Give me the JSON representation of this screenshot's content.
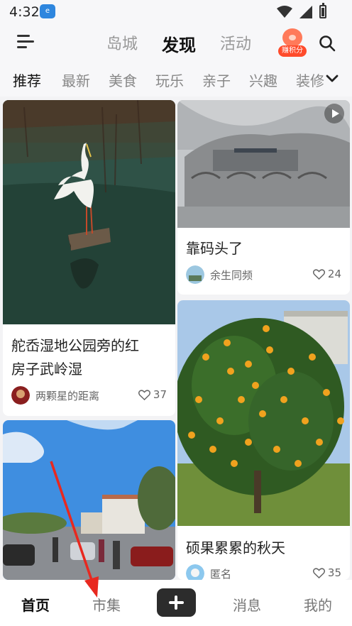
{
  "status_bar": {
    "time": "4:32",
    "app_icon": "app-badge-icon"
  },
  "header": {
    "tabs": [
      {
        "label": "岛城",
        "active": false
      },
      {
        "label": "发现",
        "active": true
      },
      {
        "label": "活动",
        "active": false
      }
    ],
    "points_label": "赚积分",
    "icons": [
      "menu-icon",
      "search-icon"
    ]
  },
  "categories": {
    "items": [
      "推荐",
      "最新",
      "美食",
      "玩乐",
      "亲子",
      "兴趣",
      "装修"
    ],
    "active_index": 0
  },
  "feed": {
    "cards": [
      {
        "title_line1": "舵岙湿地公园旁的红",
        "title_line2": "房子武岭湿",
        "author": "两颗星的距离",
        "likes": "37"
      },
      {
        "title_line1": "靠码头了",
        "title_line2": "",
        "author": "余生同频",
        "likes": "24",
        "has_video": true
      },
      {
        "title_line1": "硕果累累的秋天",
        "title_line2": "",
        "author": "匿名",
        "likes": "35"
      },
      {
        "title_line1": "",
        "title_line2": "",
        "author": "",
        "likes": ""
      }
    ]
  },
  "bottom_nav": {
    "items": [
      "首页",
      "市集",
      "消息",
      "我的"
    ],
    "active_index": 0
  },
  "colors": {
    "accent": "#222222",
    "badge_red": "#ff4b2b",
    "annotation_arrow": "#e8281f"
  }
}
